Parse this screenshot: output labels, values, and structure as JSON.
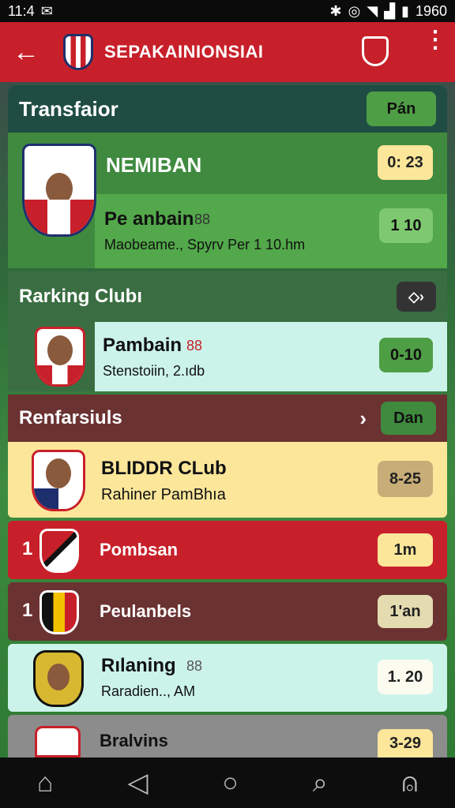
{
  "status": {
    "time": "11:4",
    "clock": "1960"
  },
  "appbar": {
    "title": "SEPAKAINIONSIAI"
  },
  "transfer": {
    "title": "Transfaior",
    "button": "Pán"
  },
  "card1": {
    "name": "NEMIBAN",
    "badge": "0: 23",
    "player": "Pe anbain",
    "tag": "88",
    "detail": "Maobeame., Spyrv Per 1 10.hm",
    "score": "1 10"
  },
  "ranking": {
    "title": "Rarking Clubı",
    "player": "Pambain",
    "tag": "88",
    "detail": "Stenstoiin, 2.ıdb",
    "score": "0-10"
  },
  "reinforce": {
    "title": "Renfarsiuls",
    "button": "Dan",
    "club": "BLIDDR CLub",
    "detail": "Rahiner PamBhıa",
    "score": "8-25"
  },
  "list": [
    {
      "rank": "1",
      "name": "Pombsan",
      "score": "1m"
    },
    {
      "rank": "1",
      "name": "Peulanbels",
      "score": "1'an"
    },
    {
      "rank": "",
      "name": "Rılaning",
      "tag": "88",
      "detail": "Raradien.., AM",
      "score": "1. 20"
    },
    {
      "rank": "",
      "name": "Bralvins",
      "score": "3-29"
    }
  ],
  "colors": {
    "red": "#c8202a",
    "darkGreen": "#3a7d3e",
    "lightGreen": "#4caf50",
    "mint": "#ccf3ea",
    "yellow": "#fbe69a",
    "maroon": "#6b3232"
  }
}
